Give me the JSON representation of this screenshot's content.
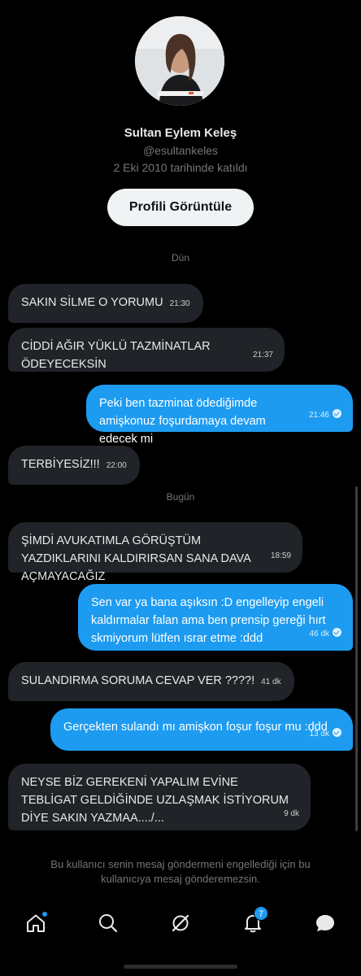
{
  "profile": {
    "name": "Sultan Eylem Keleş",
    "handle": "@esultankeles",
    "joined": "2 Eki 2010 tarihinde katıldı",
    "view_profile_label": "Profili Görüntüle"
  },
  "day_separators": {
    "yesterday": "Dün",
    "today": "Bugün"
  },
  "messages": [
    {
      "dir": "in",
      "text": "SAKIN SİLME O YORUMU",
      "time": "21:30"
    },
    {
      "dir": "in",
      "text": "CİDDİ AĞIR YÜKLÜ TAZMİNATLAR ÖDEYECEKSİN",
      "time": "21:37"
    },
    {
      "dir": "out",
      "text": "Peki ben tazminat ödediğimde amişkonuz foşurdamaya devam edecek mi",
      "time": "21:46",
      "seen": true
    },
    {
      "dir": "in",
      "text": "TERBİYESİZ!!!",
      "time": "22:00"
    },
    {
      "dir": "in",
      "text": "ŞİMDİ AVUKATIMLA GÖRÜŞTÜM YAZDIKLARINI KALDIRIRSAN SANA DAVA AÇMAYACAĞIZ",
      "time": "18:59"
    },
    {
      "dir": "out",
      "text": "Sen var ya bana aşıksın :D engelleyip engeli kaldırmalar falan ama ben prensip gereği hırt skmiyorum lütfen ısrar etme :ddd",
      "time": "46 dk",
      "seen": true
    },
    {
      "dir": "in",
      "text": "SULANDIRMA SORUMA CEVAP VER ????!",
      "time": "41 dk"
    },
    {
      "dir": "out",
      "text": "Gerçekten sulandı mı amişkon foşur foşur mu :ddd",
      "time": "13 dk",
      "seen": true
    },
    {
      "dir": "in",
      "text": "NEYSE BİZ GEREKENİ YAPALIM EVİNE TEBLİGAT GELDİĞİNDE UZLAŞMAK İSTİYORUM DİYE SAKIN YAZMAA..../...",
      "time": "9 dk"
    }
  ],
  "blocked_note": "Bu kullanıcı senin mesaj göndermeni engellediği için bu kullanıcıya mesaj gönderemezsin.",
  "tabbar": {
    "items": [
      {
        "icon": "home-icon",
        "has_dot": true
      },
      {
        "icon": "search-icon"
      },
      {
        "icon": "grok-icon"
      },
      {
        "icon": "bell-icon",
        "badge": "7"
      },
      {
        "icon": "messages-icon"
      }
    ]
  },
  "colors": {
    "accent": "#1d9bf0",
    "incoming_bubble": "#202327",
    "background": "#000000"
  }
}
